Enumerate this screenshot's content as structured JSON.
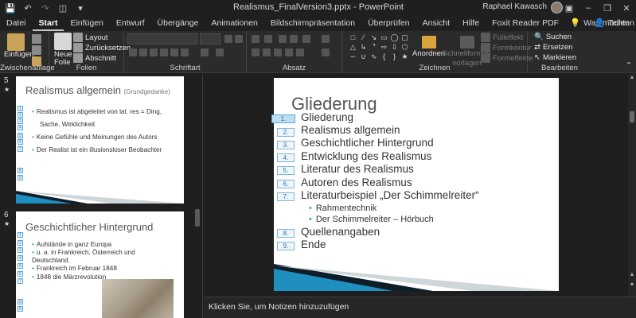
{
  "app": {
    "window_title": "Realismus_FinalVersion3.pptx  -  PowerPoint",
    "user_name": "Raphael Kawasch"
  },
  "tabs": [
    "Datei",
    "Start",
    "Einfügen",
    "Entwurf",
    "Übergänge",
    "Animationen",
    "Bildschirmpräsentation",
    "Überprüfen",
    "Ansicht",
    "Hilfe",
    "Foxit Reader PDF"
  ],
  "active_tab": "Start",
  "search_tab": "Was möchten Sie tun?",
  "share": "Teilen",
  "ribbon": {
    "clipboard": {
      "paste": "Einfügen",
      "label": "Zwischenablage"
    },
    "slides": {
      "new_slide_1": "Neue",
      "new_slide_2": "Folie",
      "layout": "Layout",
      "reset": "Zurücksetzen",
      "section": "Abschnitt",
      "label": "Folien"
    },
    "font": {
      "label": "Schriftart"
    },
    "paragraph": {
      "label": "Absatz"
    },
    "drawing": {
      "arrange": "Anordnen",
      "quick_styles_1": "Schnellformat-",
      "quick_styles_2": "vorlagen",
      "fill": "Fülleffekt",
      "outline": "Formkontur",
      "effects": "Formeffekte",
      "label": "Zeichnen"
    },
    "editing": {
      "find": "Suchen",
      "replace": "Ersetzen",
      "select": "Markieren",
      "label": "Bearbeiten"
    }
  },
  "thumbnails": [
    {
      "number": "5",
      "title": "Realismus allgemein",
      "subtitle": "(Grundgedanke)",
      "bullets": [
        "Realismus ist abgeleitet von lat. res = Ding,",
        "Sache, Wirklichkeit",
        "Keine Gefühle und Meinungen des Autors",
        "Der Realist ist ein illusionsloser Beobachter"
      ],
      "tags": [
        "1",
        "2",
        "3",
        "4",
        "5",
        "6",
        "7",
        "8",
        "9"
      ]
    },
    {
      "number": "6",
      "title": "Geschichtlicher Hintergrund",
      "bullets": [
        "Aufstände in ganz Europa",
        "u. a. in Frankreich, Österreich und Deutschland.",
        "Frankreich im Februar 1848",
        "1848 die Märzrevolution"
      ],
      "tags": [
        "1",
        "2",
        "3",
        "4",
        "5",
        "6",
        "7",
        "8",
        "9"
      ]
    }
  ],
  "slide": {
    "title": "Gliederung",
    "items": [
      {
        "n": "1.",
        "text": "Gliederung"
      },
      {
        "n": "2.",
        "text": "Realismus allgemein"
      },
      {
        "n": "3.",
        "text": "Geschichtlicher Hintergrund"
      },
      {
        "n": "4.",
        "text": "Entwicklung des Realismus"
      },
      {
        "n": "5.",
        "text": "Literatur des Realismus"
      },
      {
        "n": "6.",
        "text": "Autoren des Realismus"
      },
      {
        "n": "7.",
        "text": "Literaturbeispiel „Der Schimmelreiter“"
      }
    ],
    "subitems": [
      "Rahmentechnik",
      "Der Schimmelreiter – Hörbuch"
    ],
    "items_after": [
      {
        "n": "8.",
        "text": "Quellenangaben"
      },
      {
        "n": "9.",
        "text": "Ende"
      }
    ],
    "anim_tags": [
      "1.",
      "2.",
      "3.",
      "4.",
      "5.",
      "6.",
      "7.",
      "8.",
      "9."
    ]
  },
  "notes_placeholder": "Klicken Sie, um Notizen hinzuzufügen",
  "colors": {
    "accent": "#2aa0c8",
    "band_dark": "#0d1e2a",
    "band_blue": "#1f8fbf"
  }
}
